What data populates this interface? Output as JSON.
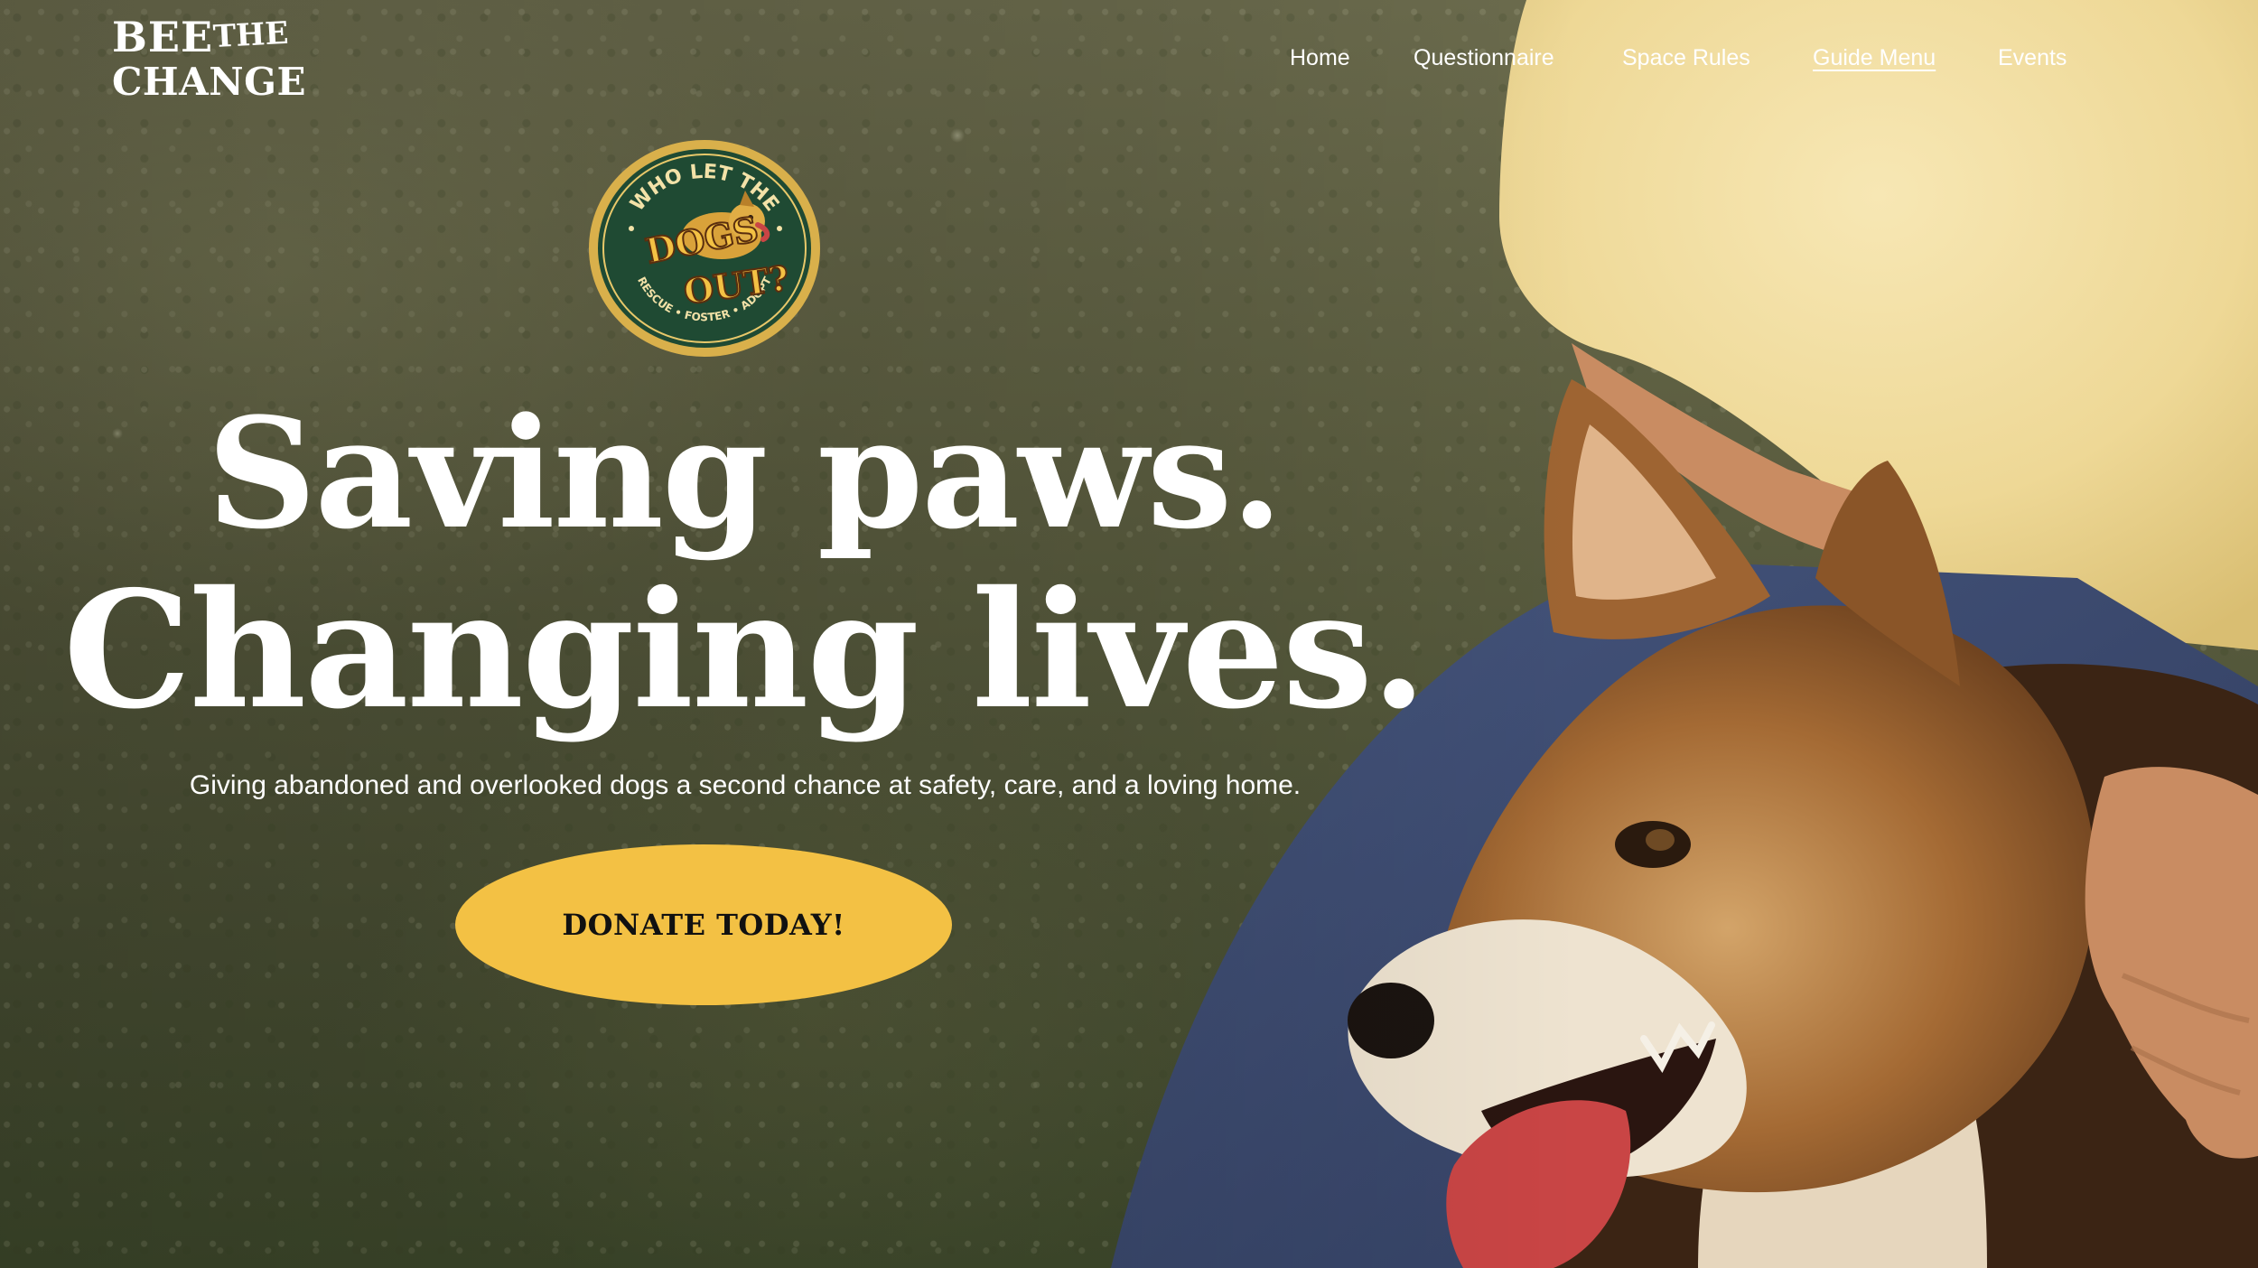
{
  "brand": {
    "line1": "BEE",
    "line1_small": "THE",
    "line2": "CHANGE"
  },
  "nav": {
    "items": [
      {
        "label": "Home",
        "active": false
      },
      {
        "label": "Questionnaire",
        "active": false
      },
      {
        "label": "Space Rules",
        "active": false
      },
      {
        "label": "Guide Menu",
        "active": true
      },
      {
        "label": "Events",
        "active": false
      }
    ]
  },
  "badge": {
    "top_text": "WHO LET THE",
    "main_word_1": "DOGS",
    "main_word_2": "OUT?",
    "bottom_text": "RESCUE • FOSTER • ADOPT",
    "icon": "dog-icon"
  },
  "hero": {
    "headline_line1": "Saving paws.",
    "headline_line2": "Changing lives.",
    "subtitle": "Giving abandoned and overlooked dogs a second chance at safety, care, and a loving home.",
    "cta_label": "DONATE TODAY!"
  },
  "colors": {
    "accent": "#f3c144",
    "text_on_hero": "#ffffff",
    "cta_text": "#111111",
    "badge_ring": "#d9b04b",
    "badge_fill": "#1f4a33"
  }
}
